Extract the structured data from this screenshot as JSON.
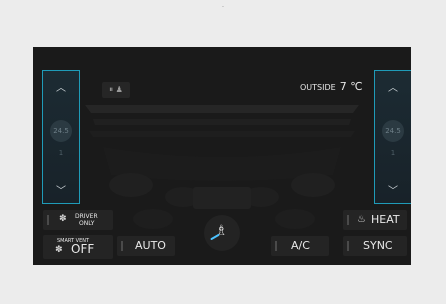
{
  "colors": {
    "accent": "#1f9bb8",
    "panel": "#1a1a1a",
    "airflow": "#4cc2ff"
  },
  "outside": {
    "label": "OUTSIDE",
    "value": "7 ℃"
  },
  "left_temp": {
    "up_icon": "chevron-up-icon",
    "down_icon": "chevron-down-icon"
  },
  "right_temp": {
    "up_icon": "chevron-up-icon",
    "down_icon": "chevron-down-icon"
  },
  "buttons": {
    "driver_only": {
      "line1": "DRIVER",
      "line2": "ONLY",
      "icon": "fan-icon"
    },
    "smart_vent": {
      "small": "SMART VENT",
      "label": "OFF",
      "icon": "fan-icon"
    },
    "auto": {
      "label": "AUTO"
    },
    "airflow": {
      "icon": "seat-airflow-icon"
    },
    "ac": {
      "label": "A/C"
    },
    "heat": {
      "label": "HEAT",
      "icon": "seat-heat-icon"
    },
    "sync": {
      "label": "SYNC"
    }
  }
}
